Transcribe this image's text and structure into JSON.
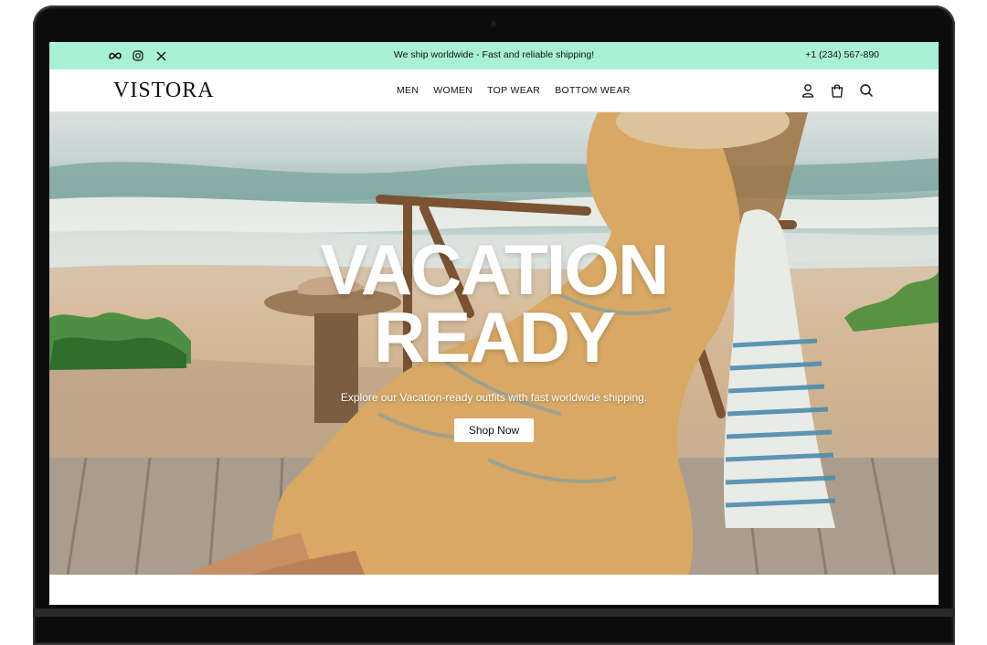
{
  "announcement_bar": {
    "message": "We ship worldwide - Fast and reliable shipping!",
    "phone": "+1 (234) 567-890",
    "background_color": "#a9f1d6",
    "social_icons": [
      "meta-icon",
      "instagram-icon",
      "x-icon"
    ]
  },
  "navbar": {
    "logo": "VISTORA",
    "menu_items": [
      "MEN",
      "WOMEN",
      "TOP WEAR",
      "BOTTOM WEAR"
    ],
    "icons": [
      "user-icon",
      "shopping-bag-icon",
      "search-icon"
    ]
  },
  "hero": {
    "headline_line1": "VACATION",
    "headline_line2": "READY",
    "subtext": "Explore our Vacation-ready outfits with fast worldwide shipping.",
    "cta_label": "Shop Now"
  }
}
